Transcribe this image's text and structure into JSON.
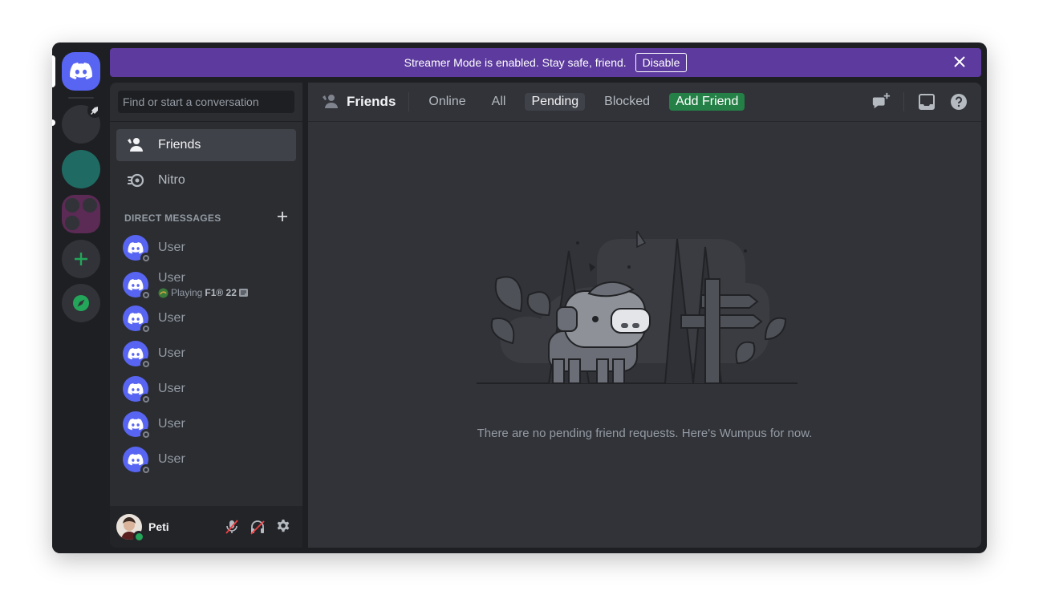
{
  "banner": {
    "message": "Streamer Mode is enabled. Stay safe, friend.",
    "button_label": "Disable"
  },
  "search": {
    "placeholder": "Find or start a conversation"
  },
  "nav": {
    "friends_label": "Friends",
    "nitro_label": "Nitro"
  },
  "direct_messages": {
    "header": "DIRECT MESSAGES",
    "items": [
      {
        "name": "User",
        "status": "offline"
      },
      {
        "name": "User",
        "status": "offline",
        "activity_prefix": "Playing ",
        "activity_game": "F1® 22"
      },
      {
        "name": "User",
        "status": "offline"
      },
      {
        "name": "User",
        "status": "offline"
      },
      {
        "name": "User",
        "status": "offline"
      },
      {
        "name": "User",
        "status": "offline"
      },
      {
        "name": "User",
        "status": "offline"
      }
    ]
  },
  "user_panel": {
    "username": "Peti",
    "status": "online"
  },
  "topbar": {
    "title": "Friends",
    "tabs": {
      "online": "Online",
      "all": "All",
      "pending": "Pending",
      "blocked": "Blocked",
      "add_friend": "Add Friend"
    },
    "selected_tab": "Pending"
  },
  "empty_state": {
    "message": "There are no pending friend requests. Here's Wumpus for now."
  },
  "colors": {
    "blurple": "#5865f2",
    "banner": "#5c3a9e",
    "green": "#23a55a",
    "add_friend": "#248046"
  }
}
